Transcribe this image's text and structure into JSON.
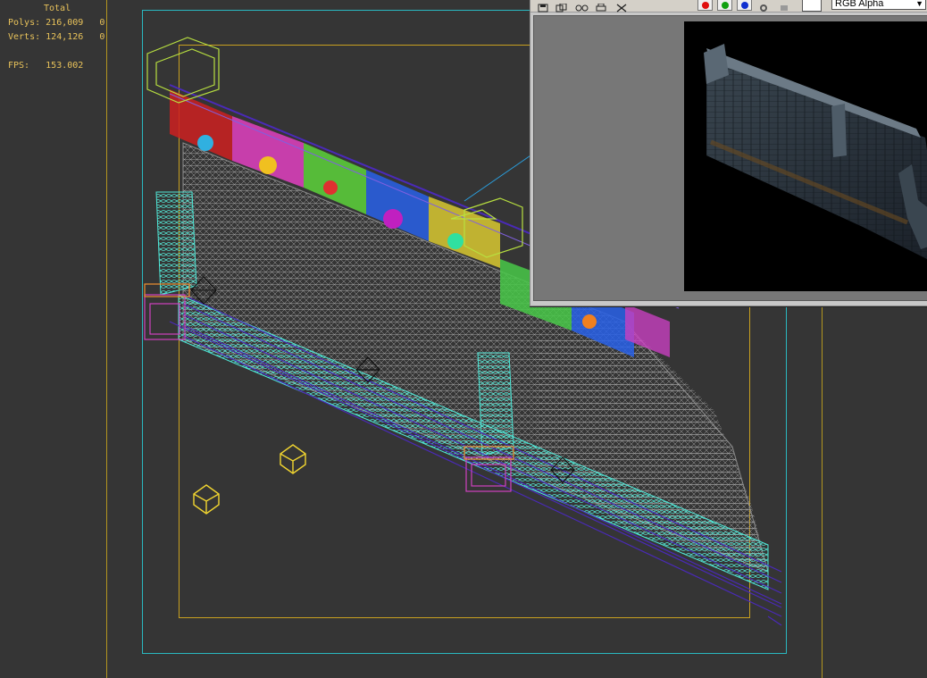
{
  "stats": {
    "header": "Total",
    "polys_label": "Polys:",
    "polys_value": "216,009",
    "polys_selected": "0",
    "verts_label": "Verts:",
    "verts_value": "124,126",
    "verts_selected": "0",
    "fps_label": "FPS:",
    "fps_value": "153.002"
  },
  "render_window": {
    "toolbar_icons": [
      "save-icon",
      "copy-icon",
      "clone-icon",
      "print-icon",
      "clear-icon"
    ],
    "channel_swatches": [
      {
        "name": "red-channel",
        "color": "#e01010"
      },
      {
        "name": "green-channel",
        "color": "#10a010"
      },
      {
        "name": "blue-channel",
        "color": "#1030d0"
      }
    ],
    "display_channel": "RGB Alpha"
  },
  "colors": {
    "viewport_bg": "#353535",
    "guide_yellow": "#c8a020",
    "frame_cyan": "#2ab8c0",
    "wireframe_gray": "#9a9a9a",
    "wireframe_aqua": "#4fe8d8",
    "wireframe_purple": "#4a2ab8",
    "camera_yellow": "#f2d630"
  }
}
